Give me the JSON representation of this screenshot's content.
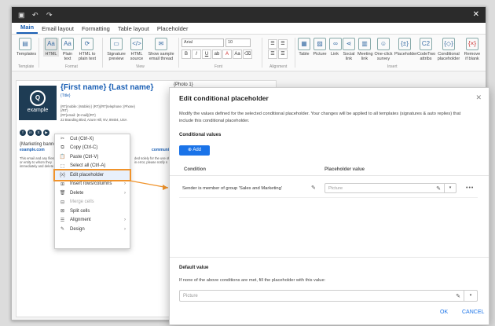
{
  "window": {
    "close_glyph": "✕"
  },
  "tabs": [
    "Main",
    "Email layout",
    "Formatting",
    "Table layout",
    "Placeholder"
  ],
  "ribbon": {
    "templates": "Templates",
    "html": "HTML",
    "plain": "Plain text",
    "html_to_plain": "HTML to plain text",
    "sig_preview": "Signature preview",
    "html_source": "HTML source",
    "show_sample": "Show sample email thread",
    "font": "Arial",
    "size": "10",
    "table": "Table",
    "picture": "Picture",
    "link": "Link",
    "social": "Social link",
    "meeting": "Meeting link",
    "survey": "One-click survey",
    "placeholder": "Placeholder",
    "codetwo": "CodeTwo attribs",
    "conditional": "Conditional placeholder",
    "remove": "Remove if blank",
    "groups": {
      "template": "Template",
      "format": "Format",
      "view": "View",
      "font": "Font",
      "alignment": "Alignment",
      "insert": "Insert"
    }
  },
  "signature": {
    "name": "{First name} {Last name}",
    "title": "{Title}",
    "mobile": "{RT}mobile: {Mobile} | {RT}{/RT}telephone: {Phone}",
    "mobile2": "{/RT}",
    "email": "{RT}email: {E-mail}{/RT}",
    "address": "22 Branding Blvd, Azure Hill, NV, 89404, USA",
    "photo": "{Photo 1}",
    "banner": "{Marketing banner}",
    "site": "example.com",
    "community": "community",
    "logo_text": "example",
    "disc1": "This email and any files",
    "disc2": "or entity to whom they",
    "disc3": "immediately and delete",
    "disc4": "ded solely for the use of",
    "disc5": "in error, please notify s"
  },
  "context_menu": [
    {
      "label": "Cut (Ctrl-X)",
      "icon": "cut-icon",
      "glyph": "✂"
    },
    {
      "label": "Copy (Ctrl-C)",
      "icon": "copy-icon",
      "glyph": "⧉"
    },
    {
      "label": "Paste (Ctrl-V)",
      "icon": "paste-icon",
      "glyph": "📋"
    },
    {
      "label": "Select all (Ctrl-A)",
      "icon": "select-all-icon",
      "glyph": "⬚"
    },
    {
      "label": "Edit placeholder",
      "icon": "placeholder-icon",
      "glyph": "{x}"
    },
    {
      "label": "Insert rows/columns",
      "icon": "insert-icon",
      "glyph": "⊞"
    },
    {
      "label": "Delete",
      "icon": "delete-icon",
      "glyph": "🗑"
    },
    {
      "label": "Merge cells",
      "icon": "merge-icon",
      "glyph": "⊟"
    },
    {
      "label": "Split cells",
      "icon": "split-icon",
      "glyph": "⊠"
    },
    {
      "label": "Alignment",
      "icon": "alignment-icon",
      "glyph": "☰"
    },
    {
      "label": "Design",
      "icon": "design-icon",
      "glyph": "✎"
    }
  ],
  "dialog": {
    "title": "Edit conditional placeholder",
    "description": "Modify the values defined for the selected conditional placeholder. Your changes will be applied to all templates (signatures & auto replies) that include this conditional placeholder.",
    "conditional_values": "Conditional values",
    "add": "Add",
    "col_condition": "Condition",
    "col_value": "Placeholder value",
    "condition": "Sender is member of group 'Sales and Marketing'",
    "placeholder_value": "Picture",
    "default_value": "Default value",
    "default_desc": "If none of the above conditions are met, fill the placeholder with this value:",
    "default_placeholder": "Picture",
    "ok": "OK",
    "cancel": "CANCEL"
  },
  "colors": {
    "accent": "#1a73e8",
    "highlight": "#f0932b",
    "brand": "#1e3c54"
  }
}
